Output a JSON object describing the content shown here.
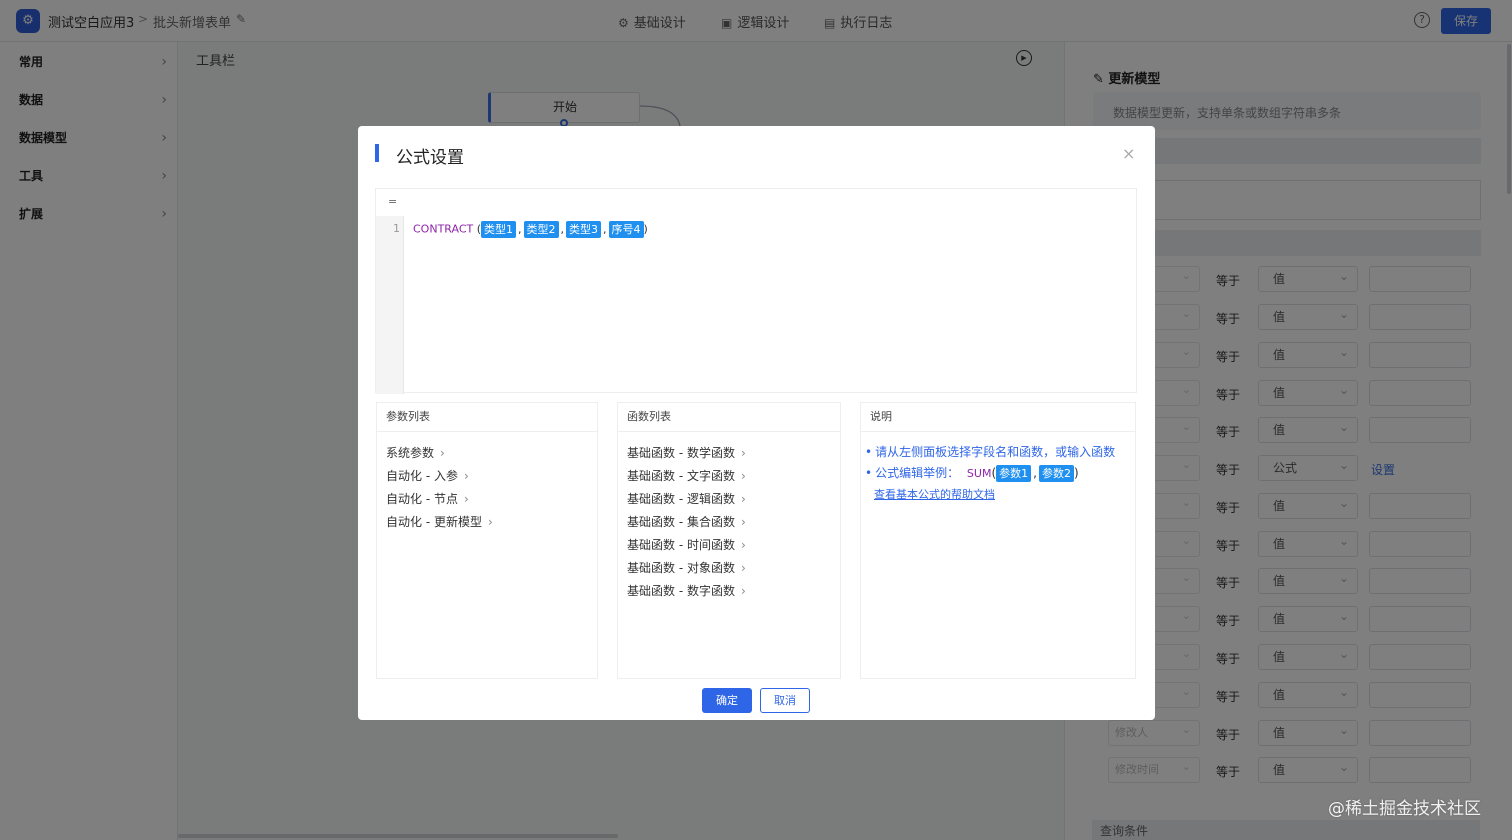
{
  "topbar": {
    "app_name": "测试空白应用3",
    "crumb_sep": ">",
    "page_name": "批头新增表单",
    "nav": [
      {
        "label": "基础设计",
        "icon": "gear-icon"
      },
      {
        "label": "逻辑设计",
        "icon": "logic-icon"
      },
      {
        "label": "执行日志",
        "icon": "document-icon"
      }
    ],
    "help": "?",
    "save_label": "保存"
  },
  "sidebar": {
    "items": [
      {
        "label": "常用"
      },
      {
        "label": "数据"
      },
      {
        "label": "数据模型"
      },
      {
        "label": "工具"
      },
      {
        "label": "扩展"
      }
    ]
  },
  "canvas": {
    "toolbar_label": "工具栏",
    "start_node": "开始"
  },
  "right_panel": {
    "title": "更新模型",
    "description": "数据模型更新，支持单条或数组字符串多条",
    "rows": [
      {
        "op": "等于",
        "type": "值",
        "field": ""
      },
      {
        "op": "等于",
        "type": "值",
        "field": ""
      },
      {
        "op": "等于",
        "type": "值",
        "field": ""
      },
      {
        "op": "等于",
        "type": "值",
        "field": ""
      },
      {
        "op": "等于",
        "type": "值",
        "field": ""
      },
      {
        "op": "等于",
        "type": "公式",
        "field": "",
        "link": "设置"
      },
      {
        "op": "等于",
        "type": "值",
        "field": ""
      },
      {
        "op": "等于",
        "type": "值",
        "field": ""
      },
      {
        "op": "等于",
        "type": "值",
        "field": ""
      },
      {
        "op": "等于",
        "type": "值",
        "field": ""
      },
      {
        "op": "等于",
        "type": "值",
        "field": ""
      },
      {
        "op": "等于",
        "type": "值",
        "field": ""
      },
      {
        "op": "等于",
        "type": "值",
        "field": "修改人"
      },
      {
        "op": "等于",
        "type": "值",
        "field": "修改时间"
      }
    ],
    "query_section": "查询条件"
  },
  "watermark": "@稀土掘金技术社区",
  "modal": {
    "title": "公式设置",
    "close": "×",
    "editor": {
      "eq": "=",
      "line_no": "1",
      "function": "CONTRACT",
      "open_paren": "(",
      "close_paren": ")",
      "params": [
        "类型1",
        "类型2",
        "类型3",
        "序号4"
      ],
      "separator": ","
    },
    "params_pane": {
      "title": "参数列表",
      "items": [
        "系统参数",
        "自动化 - 入参",
        "自动化 - 节点",
        "自动化 - 更新模型"
      ]
    },
    "functions_pane": {
      "title": "函数列表",
      "items": [
        "基础函数 - 数学函数",
        "基础函数 - 文字函数",
        "基础函数 - 逻辑函数",
        "基础函数 - 集合函数",
        "基础函数 - 时间函数",
        "基础函数 - 对象函数",
        "基础函数 - 数字函数"
      ]
    },
    "help_pane": {
      "title": "说明",
      "line1": "请从左侧面板选择字段名和函数，或输入函数",
      "line2_prefix": "公式编辑举例：",
      "example_fn": "SUM",
      "example_params": [
        "参数1",
        "参数2"
      ],
      "link": "查看基本公式的帮助文档"
    },
    "ok_label": "确定",
    "cancel_label": "取消"
  },
  "colors": {
    "primary": "#2f66e8",
    "tag": "#1f8ff0",
    "function_name": "#8e24aa"
  }
}
